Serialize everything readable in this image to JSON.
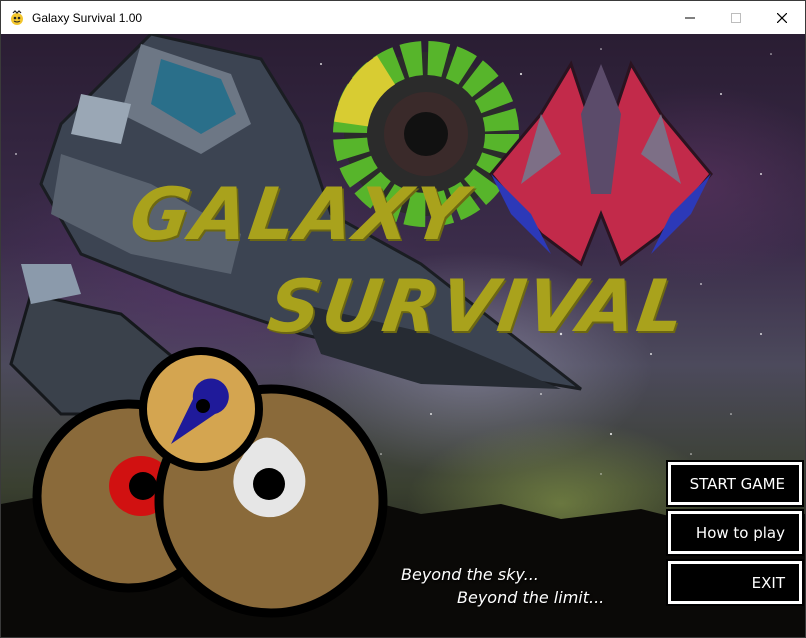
{
  "window": {
    "title": "Galaxy Survival 1.00",
    "controls": {
      "minimize": "minimize-icon",
      "maximize": "maximize-icon",
      "close": "close-icon"
    }
  },
  "game": {
    "logo": {
      "line1": "GALAXY",
      "line2": "SURVIVAL",
      "color": "#a9a21c"
    },
    "tagline": {
      "line1": "Beyond the sky...",
      "line2": "Beyond the limit..."
    },
    "menu": {
      "start_label": "START GAME",
      "how_label": "How to play",
      "exit_label": "EXIT"
    },
    "colors": {
      "button_border": "#ffffff",
      "button_bg": "#000000",
      "text": "#ffffff"
    }
  }
}
